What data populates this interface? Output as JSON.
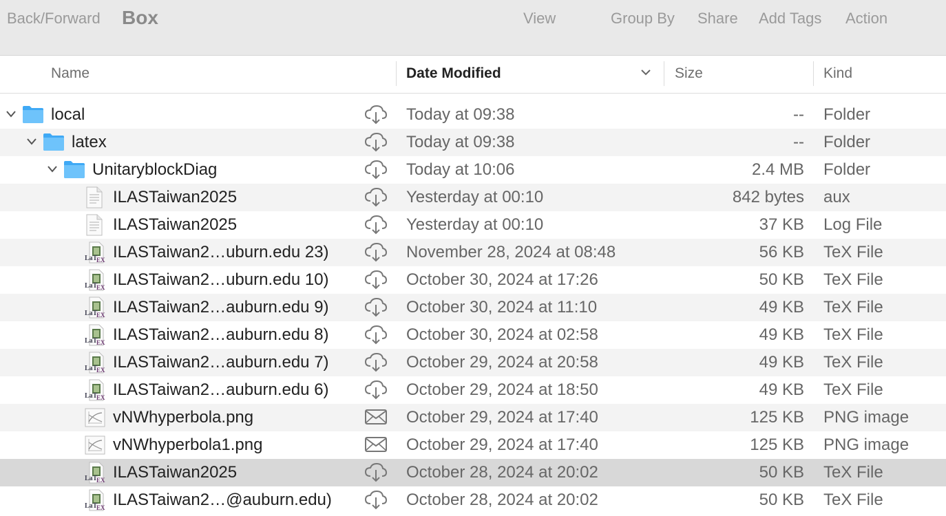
{
  "toolbar": {
    "back_forward": "Back/Forward",
    "title": "Box",
    "view": "View",
    "group_by": "Group By",
    "share": "Share",
    "add_tags": "Add Tags",
    "action": "Action"
  },
  "columns": {
    "name": "Name",
    "date_modified": "Date Modified",
    "size": "Size",
    "kind": "Kind"
  },
  "rows": [
    {
      "name": "local",
      "date": "Today at 09:38",
      "size": "--",
      "kind": "Folder",
      "icon": "folder-icon",
      "status": "cloud-icon"
    },
    {
      "name": "latex",
      "date": "Today at 09:38",
      "size": "--",
      "kind": "Folder",
      "icon": "folder-icon",
      "status": "cloud-icon"
    },
    {
      "name": "UnitaryblockDiag",
      "date": "Today at 10:06",
      "size": "2.4 MB",
      "kind": "Folder",
      "icon": "folder-icon",
      "status": "cloud-icon"
    },
    {
      "name": "ILASTaiwan2025",
      "date": "Yesterday at 00:10",
      "size": "842 bytes",
      "kind": "aux",
      "icon": "document-icon",
      "status": "cloud-icon"
    },
    {
      "name": "ILASTaiwan2025",
      "date": "Yesterday at 00:10",
      "size": "37 KB",
      "kind": "Log File",
      "icon": "document-icon",
      "status": "cloud-icon"
    },
    {
      "name": "ILASTaiwan2…uburn.edu 23)",
      "date": "November 28, 2024 at 08:48",
      "size": "56 KB",
      "kind": "TeX File",
      "icon": "tex-file-icon",
      "status": "cloud-icon"
    },
    {
      "name": "ILASTaiwan2…uburn.edu 10)",
      "date": "October 30, 2024 at 17:26",
      "size": "50 KB",
      "kind": "TeX File",
      "icon": "tex-file-icon",
      "status": "cloud-icon"
    },
    {
      "name": "ILASTaiwan2…auburn.edu 9)",
      "date": "October 30, 2024 at 11:10",
      "size": "49 KB",
      "kind": "TeX File",
      "icon": "tex-file-icon",
      "status": "cloud-icon"
    },
    {
      "name": "ILASTaiwan2…auburn.edu 8)",
      "date": "October 30, 2024 at 02:58",
      "size": "49 KB",
      "kind": "TeX File",
      "icon": "tex-file-icon",
      "status": "cloud-icon"
    },
    {
      "name": "ILASTaiwan2…auburn.edu 7)",
      "date": "October 29, 2024 at 20:58",
      "size": "49 KB",
      "kind": "TeX File",
      "icon": "tex-file-icon",
      "status": "cloud-icon"
    },
    {
      "name": "ILASTaiwan2…auburn.edu 6)",
      "date": "October 29, 2024 at 18:50",
      "size": "49 KB",
      "kind": "TeX File",
      "icon": "tex-file-icon",
      "status": "cloud-icon"
    },
    {
      "name": "vNWhyperbola.png",
      "date": "October 29, 2024 at 17:40",
      "size": "125 KB",
      "kind": "PNG image",
      "icon": "image-icon",
      "status": "mail-icon"
    },
    {
      "name": "vNWhyperbola1.png",
      "date": "October 29, 2024 at 17:40",
      "size": "125 KB",
      "kind": "PNG image",
      "icon": "image-icon",
      "status": "mail-icon"
    },
    {
      "name": "ILASTaiwan2025",
      "date": "October 28, 2024 at 20:02",
      "size": "50 KB",
      "kind": "TeX File",
      "icon": "tex-file-icon",
      "status": "cloud-icon"
    },
    {
      "name": "ILASTaiwan2…@auburn.edu)",
      "date": "October 28, 2024 at 20:02",
      "size": "50 KB",
      "kind": "TeX File",
      "icon": "tex-file-icon",
      "status": "cloud-icon"
    }
  ]
}
